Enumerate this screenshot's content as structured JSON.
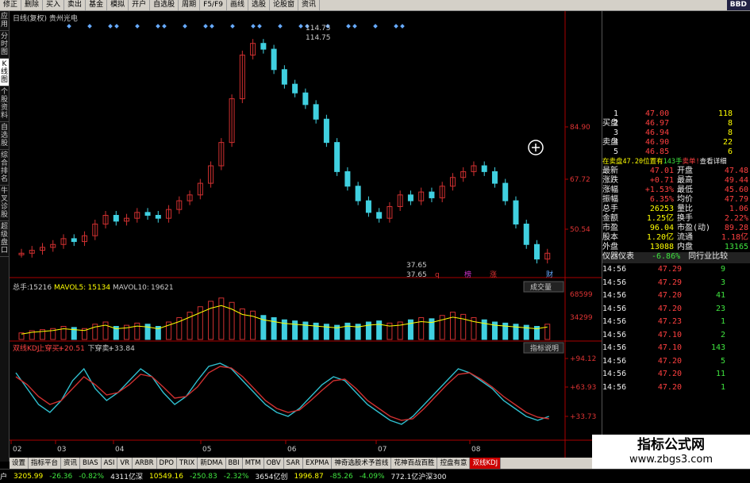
{
  "toolbar": {
    "items": [
      "修正",
      "删除",
      "买入",
      "卖出",
      "基金",
      "模拟",
      "开户",
      "自选股",
      "周期",
      "F5/F9",
      "画线",
      "选股",
      "论股窗",
      "资讯"
    ],
    "bbd": "BBD"
  },
  "sidebar": {
    "items": [
      "应用",
      "分时图",
      "K线图",
      "个股资料",
      "自选股",
      "综合排名",
      "牛叉诊股",
      "超级盘口"
    ]
  },
  "main_chart": {
    "title": "日线(复权) 贵州光电",
    "price_labels": [
      "84.90",
      "67.72",
      "50.54"
    ],
    "high_marks": [
      "114.75",
      "114.75"
    ],
    "low_marks": [
      "37.65",
      "37.65"
    ],
    "event_marks": [
      "q",
      "榜",
      "涨",
      "财"
    ],
    "colors": {
      "up": "#d03030",
      "down": "#40d0e0"
    }
  },
  "volume": {
    "label_prefix": "总手:",
    "total": "15216",
    "mavol5_label": "MAVOL5:",
    "mavol5": "15134",
    "mavol10_label": "MAVOL10:",
    "mavol10": "19621",
    "button": "成交量",
    "axis": [
      "68599",
      "34299"
    ]
  },
  "kdj": {
    "label": "双线KDJ",
    "up_label": "上穿买:",
    "up_val": "+20.51",
    "down_label": "下穿卖:",
    "down_val": "+33.84",
    "button": "指标说明",
    "axis": [
      "+94.12",
      "+63.93",
      "+33.73"
    ]
  },
  "x_axis": [
    "02",
    "03",
    "04",
    "05",
    "06",
    "07",
    "08"
  ],
  "chart_data": {
    "type": "candlestick",
    "series": [
      {
        "name": "price",
        "values": [
          42,
          43,
          44,
          45,
          47,
          46,
          48,
          52,
          55,
          53,
          54,
          56,
          55,
          54,
          57,
          60,
          62,
          66,
          72,
          80,
          95,
          110,
          114,
          112,
          105,
          100,
          97,
          93,
          88,
          80,
          70,
          65,
          60,
          56,
          54,
          58,
          62,
          60,
          63,
          61,
          65,
          68,
          70,
          72,
          70,
          66,
          60,
          52,
          45,
          40,
          42
        ]
      },
      {
        "name": "volume",
        "values": [
          6,
          8,
          9,
          10,
          12,
          11,
          10,
          14,
          16,
          12,
          13,
          15,
          14,
          12,
          16,
          20,
          25,
          30,
          35,
          38,
          34,
          28,
          26,
          22,
          20,
          18,
          17,
          16,
          15,
          14,
          13,
          15,
          14,
          16,
          17,
          15,
          16,
          18,
          20,
          19,
          22,
          25,
          23,
          20,
          18,
          16,
          15,
          14,
          13,
          12,
          14
        ]
      },
      {
        "name": "KDJ-K",
        "values": [
          80,
          60,
          40,
          30,
          45,
          70,
          85,
          60,
          45,
          55,
          70,
          85,
          75,
          55,
          40,
          50,
          70,
          88,
          92,
          85,
          70,
          55,
          40,
          30,
          25,
          35,
          50,
          65,
          75,
          70,
          55,
          40,
          30,
          20,
          15,
          25,
          40,
          55,
          70,
          85,
          80,
          70,
          60,
          45,
          35,
          25,
          20,
          25
        ]
      },
      {
        "name": "KDJ-D",
        "values": [
          75,
          65,
          50,
          40,
          45,
          60,
          75,
          65,
          52,
          55,
          65,
          78,
          75,
          62,
          48,
          50,
          62,
          80,
          88,
          86,
          75,
          60,
          45,
          35,
          30,
          33,
          45,
          58,
          70,
          72,
          60,
          45,
          35,
          25,
          20,
          22,
          35,
          50,
          65,
          78,
          80,
          72,
          62,
          50,
          40,
          30,
          24,
          22
        ]
      }
    ]
  },
  "quote": {
    "side_buy": "买盘",
    "side_sell": "卖盘",
    "levels": [
      [
        "1",
        "47.00",
        "118"
      ],
      [
        "2",
        "46.97",
        "8"
      ],
      [
        "3",
        "46.94",
        "8"
      ],
      [
        "4",
        "46.90",
        "22"
      ],
      [
        "5",
        "46.85",
        "6"
      ]
    ],
    "sellinfo": "在卖盘47.20位置有",
    "sellqty": "143手",
    "sellaction": "卖单!",
    "detail": "查看详细",
    "stats": [
      [
        "最新",
        "47.01",
        "开盘",
        "47.48"
      ],
      [
        "涨跌",
        "+0.71",
        "最高",
        "49.44"
      ],
      [
        "涨幅",
        "+1.53%",
        "最低",
        "45.60"
      ],
      [
        "振幅",
        "6.35%",
        "均价",
        "47.79"
      ],
      [
        "总手",
        "26253",
        "量比",
        "1.06"
      ],
      [
        "金额",
        "1.25亿",
        "换手",
        "2.22%"
      ],
      [
        "市盈",
        "96.04",
        "市盈(动)",
        "89.28"
      ],
      [
        "股本",
        "1.20亿",
        "流通",
        "1.18亿"
      ],
      [
        "外盘",
        "13088",
        "内盘",
        "13165"
      ]
    ],
    "panel_label": "仪器仪表",
    "panel_pct": "-6.86%",
    "panel_cmp": "同行业比较",
    "ticks": [
      [
        "14:56",
        "47.29",
        "9"
      ],
      [
        "14:56",
        "47.29",
        "3"
      ],
      [
        "14:56",
        "47.20",
        "41"
      ],
      [
        "14:56",
        "47.20",
        "23"
      ],
      [
        "14:56",
        "47.23",
        "1"
      ],
      [
        "14:56",
        "47.10",
        "2"
      ],
      [
        "14:56",
        "47.10",
        "143"
      ],
      [
        "14:56",
        "47.20",
        "5"
      ],
      [
        "14:56",
        "47.20",
        "11"
      ],
      [
        "14:56",
        "47.20",
        "1"
      ]
    ]
  },
  "tabs": [
    "设置",
    "指标平台",
    "资讯",
    "BIAS",
    "ASI",
    "VR",
    "ARBR",
    "DPO",
    "TRIX",
    "新DMA",
    "BBI",
    "MTM",
    "OBV",
    "SAR",
    "EXPMA",
    "神奇选股术予首线",
    "花神百战百胜",
    "控盘有意",
    "双线KDJ"
  ],
  "status": {
    "items": [
      "户",
      "3205.99",
      "-26.36",
      "-0.82%",
      "4311亿深",
      "10549.16",
      "-250.83",
      "-2.32%",
      "3654亿创",
      "1996.87",
      "-85.26",
      "-4.09%",
      "772.1亿沪深300"
    ]
  },
  "watermark": {
    "line1": "指标公式网",
    "line2": "www.zbgs3.com"
  }
}
